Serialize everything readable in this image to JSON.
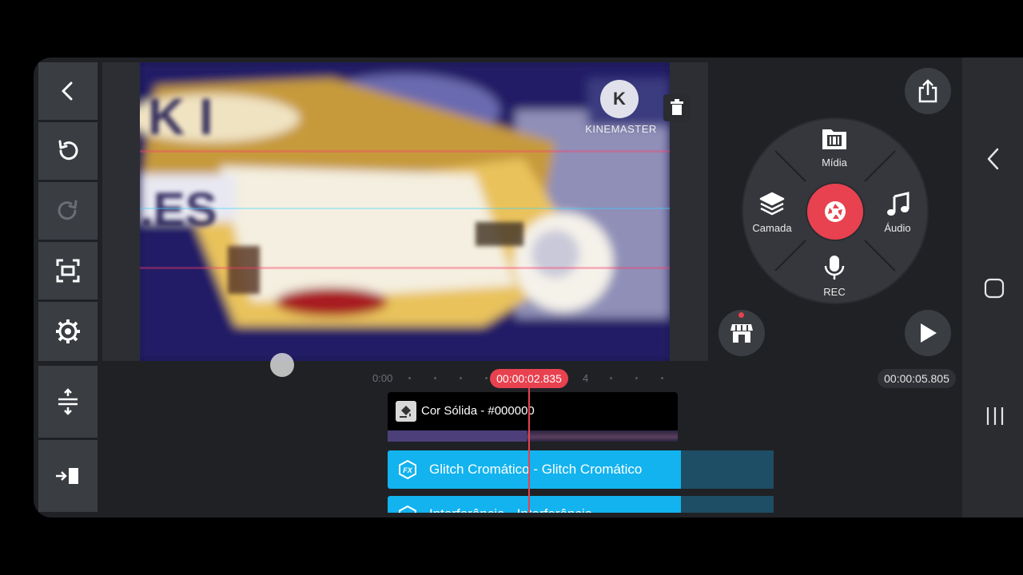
{
  "preview": {
    "watermark_label": "KINEMASTER",
    "watermark_letter": "K"
  },
  "menu": {
    "media_label": "Mídia",
    "layer_label": "Camada",
    "audio_label": "Áudio",
    "rec_label": "REC"
  },
  "timeline": {
    "start_tick": "0:00",
    "tick_4": "4",
    "playhead_time": "00:00:02.835",
    "total_duration": "00:00:05.805",
    "tracks": {
      "solid_color_label": "Cor Sólida - #000000",
      "fx1_label": "Glitch Cromático - Glitch Cromático",
      "fx2_label": "Interferência - Interferência"
    }
  },
  "colors": {
    "accent": "#e8414f",
    "fx_clip": "#12b3ee",
    "panel": "#3a3d42",
    "background": "#1f2125"
  },
  "icons": {
    "back": "chevron-left-icon",
    "undo": "undo-icon",
    "redo": "redo-icon",
    "fullscreen": "fullscreen-icon",
    "settings": "gear-icon",
    "share": "share-icon",
    "store": "store-icon",
    "play": "play-icon",
    "delete": "trash-icon"
  }
}
